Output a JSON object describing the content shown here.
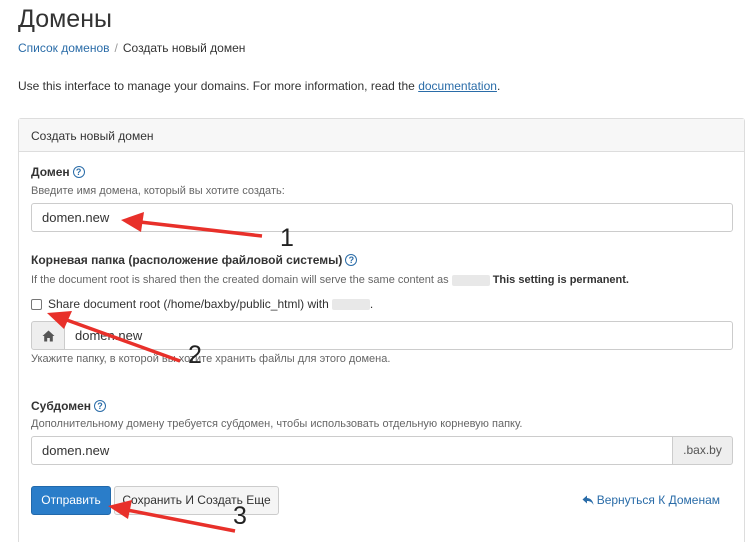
{
  "page": {
    "title": "Домены"
  },
  "breadcrumb": {
    "link": "Список доменов",
    "separator": "/",
    "current": "Создать новый домен"
  },
  "intro": {
    "text": "Use this interface to manage your domains. For more information, read the ",
    "link": "documentation",
    "suffix": "."
  },
  "panel": {
    "heading": "Создать новый домен"
  },
  "domain": {
    "label": "Домен",
    "hint": "Введите имя домена, который вы хотите создать:",
    "value": "domen.new"
  },
  "docroot": {
    "label": "Корневая папка (расположение файловой системы)",
    "hint": "If the document root is shared then the created domain will serve the same content as",
    "hint_bold": "This setting is permanent.",
    "share_label": "Share document root (/home/baxby/public_html) with",
    "share_suffix": ".",
    "value": "domen.new",
    "helper": "Укажите папку, в которой вы хотите хранить файлы для этого домена."
  },
  "subdomain": {
    "label": "Субдомен",
    "hint": "Дополнительному домену требуется субдомен, чтобы использовать отдельную корневую папку.",
    "value": "domen.new",
    "suffix": ".bax.by"
  },
  "buttons": {
    "submit": "Отправить",
    "save_and_create": "Сохранить И Создать Еще"
  },
  "back_link": {
    "label": "Вернуться К Доменам"
  },
  "annotations": {
    "n1": "1",
    "n2": "2",
    "n3": "3",
    "arrow_color": "#e8302a"
  },
  "icons": {
    "help": "question-circle-icon",
    "home": "home-icon",
    "back": "reply-arrow-icon"
  },
  "colors": {
    "link": "#2a6ca8",
    "primary": "#2a7dc9"
  }
}
